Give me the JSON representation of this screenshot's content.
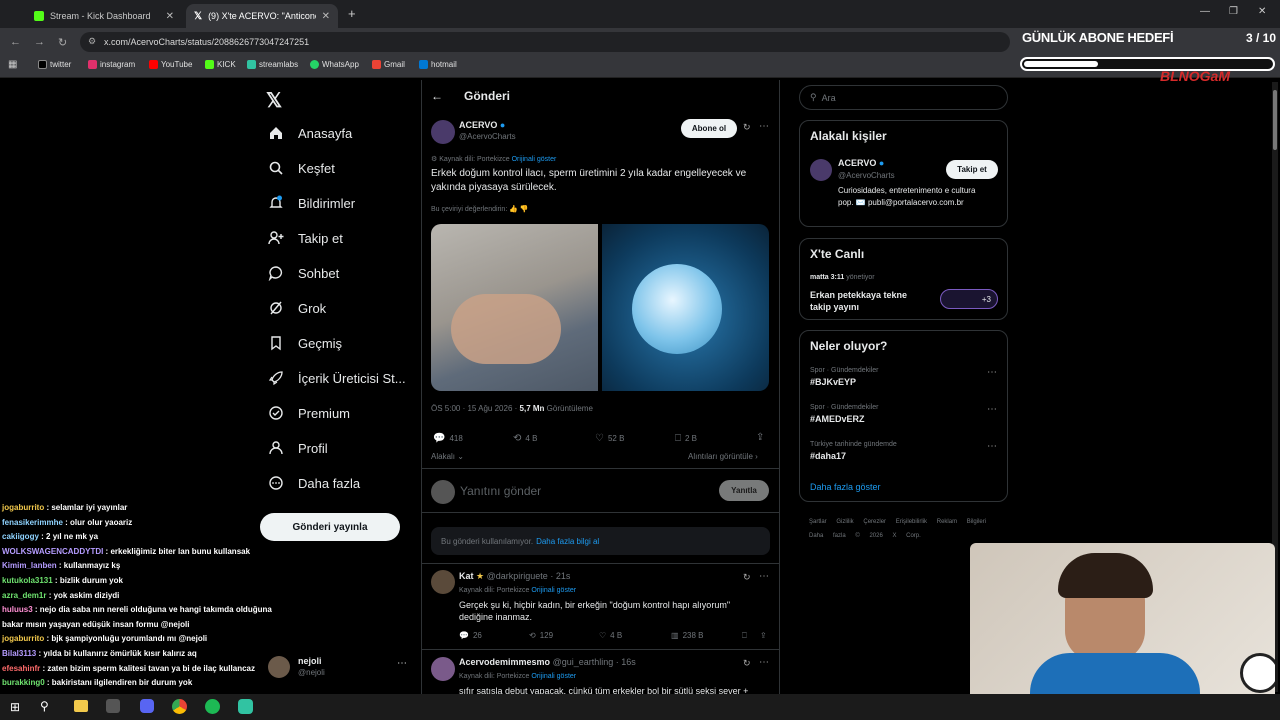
{
  "browser": {
    "tabs": [
      {
        "title": "Stream - Kick Dashboard"
      },
      {
        "title": "(9) X'te ACERVO: \"Anticonceptio"
      }
    ],
    "url": "x.com/AcervoCharts/status/2088626773047247251",
    "bookmarks": [
      "twitter",
      "instagram",
      "YouTube",
      "KICK",
      "streamlabs",
      "WhatsApp",
      "Gmail",
      "hotmail"
    ]
  },
  "overlay": {
    "goal_title": "GÜNLÜK ABONE HEDEFİ",
    "goal_count": "3 / 10",
    "goal_progress": 0.3,
    "logo": "BLNOGaM"
  },
  "nav": {
    "items": [
      "Anasayfa",
      "Keşfet",
      "Bildirimler",
      "Takip et",
      "Sohbet",
      "Grok",
      "Geçmiş",
      "İçerik Üreticisi St...",
      "Premium",
      "Profil",
      "Daha fazla"
    ],
    "post_button": "Gönderi yayınla",
    "account_name": "nejoli",
    "account_handle": "@nejoli"
  },
  "post": {
    "header": "Gönderi",
    "author": "ACERVO",
    "handle": "@AcervoCharts",
    "follow_button": "Abone ol",
    "translated_from": "Kaynak dili: Portekizce",
    "show_original": "Orijinali göster",
    "text": "Erkek doğum kontrol ilacı, sperm üretimini 2 yıla kadar engelleyecek ve yakında piyasaya sürülecek.",
    "rate_translation": "Bu çeviriyi değerlendirin:",
    "time": "ÖS 5:00 · 15 Ağu 2026 ·",
    "views_count": "5,7 Mn",
    "views_label": "Görüntüleme",
    "replies": "418",
    "reposts": "4 B",
    "likes": "52 B",
    "bookmarks": "2 B",
    "related": "Alakalı",
    "show_quotes": "Alıntıları görüntüle",
    "reply_placeholder": "Yanıtını gönder",
    "reply_button": "Yanıtla",
    "notice": "Bu gönderi kullanılamıyor.",
    "notice_link": "Daha fazla bilgi al"
  },
  "replies": [
    {
      "name": "Kat",
      "handle": "@darkpiriguete",
      "time": "21s",
      "translated": "Kaynak dili: Portekizce",
      "original": "Orijinali göster",
      "text": "Gerçek şu ki, hiçbir kadın, bir erkeğin \"doğum kontrol hapı alıyorum\" dediğine inanmaz.",
      "replies": "26",
      "reposts": "129",
      "likes": "4 B",
      "views": "238 B"
    },
    {
      "name": "Acervodemimmesmo",
      "handle": "@gui_earthling",
      "time": "16s",
      "translated": "Kaynak dili: Portekizce",
      "original": "Orijinali göster",
      "text": "sıfır satışla debut yapacak, çünkü tüm erkekler bol bir sütlü seksi sever +"
    }
  ],
  "sidebar": {
    "search_placeholder": "Ara",
    "related_title": "Alakalı kişiler",
    "related_name": "ACERVO",
    "related_handle": "@AcervoCharts",
    "related_button": "Takip et",
    "related_bio": "Curiosidades, entretenimento e cultura pop. ✉️ publi@portalacervo.com.br",
    "live_title": "X'te Canlı",
    "live_host": "matta 3:11",
    "live_role": "yönetiyor",
    "live_text": "Erkan petekkaya tekne takip yayını",
    "live_extra": "+3",
    "trends_title": "Neler oluyor?",
    "trends": [
      {
        "category": "Spor · Gündemdekiler",
        "tag": "#BJKvEYP"
      },
      {
        "category": "Spor · Gündemdekiler",
        "tag": "#AMEDvERZ"
      },
      {
        "category": "Türkiye tarihinde gündemde",
        "tag": "#daha17"
      }
    ],
    "show_more": "Daha fazla göster",
    "footer": [
      "Şartlar",
      "Gizlilik",
      "Çerezler",
      "Erişilebilirlik",
      "Reklam Bilgileri",
      "Daha fazla",
      "© 2026 X Corp."
    ]
  },
  "chat": [
    {
      "user": "jogaburrito",
      "msg": " : selamlar iyi yayınlar",
      "color": "#f2c94c"
    },
    {
      "user": "fenasikerimmhe",
      "msg": " : olur olur yaoariz",
      "color": "#8fd3ff"
    },
    {
      "user": "cakiigogy",
      "msg": " : 2 yıl ne mk ya",
      "color": "#8fd3ff"
    },
    {
      "user": "WOLKSWAGENCADDYTDI",
      "msg": " : erkekliğimiz biter lan bunu kullansak",
      "color": "#b59cff"
    },
    {
      "user": "Kimim_lanben",
      "msg": " : kullanmayız kş",
      "color": "#b59cff"
    },
    {
      "user": "kutukola3131",
      "msg": " : bizlik durum yok",
      "color": "#6fe36f"
    },
    {
      "user": "azra_dem1r",
      "msg": " : yok askim diziydi",
      "color": "#6fe36f"
    },
    {
      "user": "huluus3",
      "msg": " : nejo dia saba nın nereli olduğuna ve hangi takımda olduğuna",
      "color": "#ff8fd3"
    },
    {
      "user": "",
      "msg": "bakar mısın yaşayan edüşük insan formu @nejoli",
      "color": "#fff"
    },
    {
      "user": "jogaburrito",
      "msg": " : bjk şampiyonluğu yorumlandı mı @nejoli",
      "color": "#f2c94c"
    },
    {
      "user": "Bilal3113",
      "msg": " : yılda bi kullanırız ömürlük kısır kalırız aq",
      "color": "#b59cff"
    },
    {
      "user": "efesahinfr",
      "msg": " : zaten bizim sperm kalitesi tavan ya bi de ilaç kullancaz",
      "color": "#ff6b6b"
    },
    {
      "user": "burakking0",
      "msg": " : bakiristanı ilgilendiren bir durum yok",
      "color": "#6fe36f"
    },
    {
      "user": "BROFAZZSAVAGE",
      "msg": " : eee var zaten şap",
      "color": "#f2c94c"
    }
  ],
  "colors": {
    "accent": "#1d9bf0",
    "bg": "#000000",
    "border": "#2f3336",
    "muted": "#71767b"
  }
}
